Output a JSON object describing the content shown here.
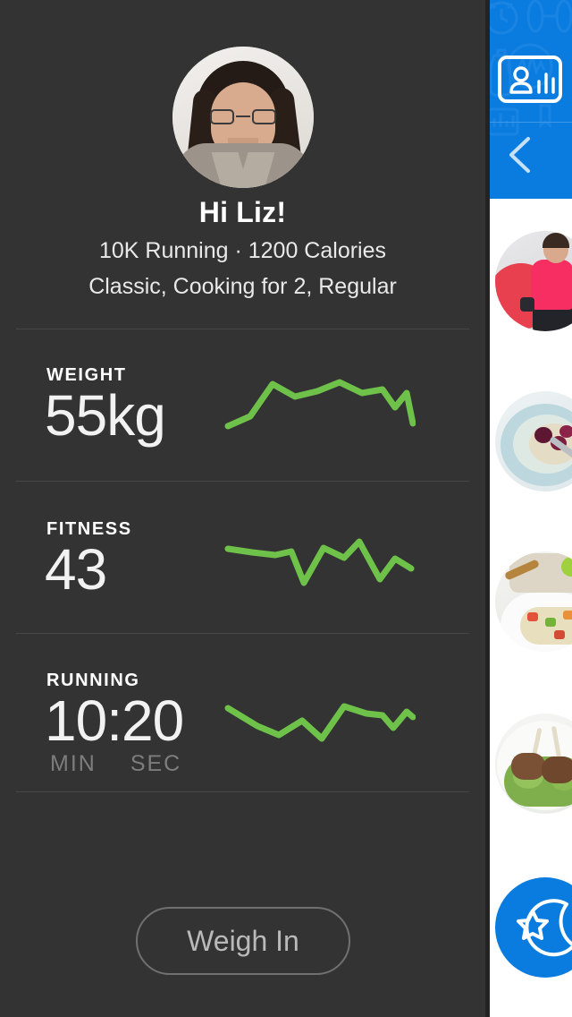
{
  "profile": {
    "avatar_name": "user-avatar-photo",
    "greeting": "Hi Liz!",
    "goals_line": "10K Running  ·  1200 Calories",
    "prefs_line": "Classic, Cooking for 2, Regular"
  },
  "stats": [
    {
      "label": "WEIGHT",
      "value": "55kg",
      "units": null,
      "sparkline_name": "weight-sparkline"
    },
    {
      "label": "FITNESS",
      "value": "43",
      "units": null,
      "sparkline_name": "fitness-sparkline"
    },
    {
      "label": "RUNNING",
      "value": "10:20",
      "units": {
        "min": "MIN",
        "sec": "SEC"
      },
      "sparkline_name": "running-sparkline"
    }
  ],
  "actions": {
    "weigh_in_label": "Weigh In"
  },
  "right_panel": {
    "badge_icon": "person-stats-badge-icon",
    "back_icon": "chevron-left-icon",
    "thumbnails": [
      {
        "name": "thumb-workout-woman"
      },
      {
        "name": "thumb-berry-oatmeal-bowl"
      },
      {
        "name": "thumb-salad-plate"
      },
      {
        "name": "thumb-lamb-chops-peas"
      }
    ],
    "moon_icon": "moon-star-icon"
  },
  "colors": {
    "panel_bg": "#333333",
    "accent_green": "#6ec24a",
    "accent_blue": "#0a7ce0",
    "divider": "#474747",
    "muted_text": "#7d7d7d"
  },
  "chart_data": [
    {
      "type": "line",
      "title": "WEIGHT",
      "series": [
        {
          "name": "weight",
          "values": [
            12,
            40,
            74,
            58,
            66,
            78,
            62,
            60,
            70,
            42,
            66,
            22
          ]
        }
      ],
      "x": [
        0,
        1,
        2,
        3,
        4,
        5,
        6,
        7,
        8,
        9,
        10,
        11
      ],
      "ylim": [
        0,
        100
      ],
      "xlabel": "",
      "ylabel": "",
      "grid": false,
      "legend": "none"
    },
    {
      "type": "line",
      "title": "FITNESS",
      "series": [
        {
          "name": "fitness",
          "values": [
            70,
            62,
            58,
            60,
            66,
            8,
            70,
            48,
            52,
            82,
            18,
            56,
            34
          ]
        }
      ],
      "x": [
        0,
        1,
        2,
        3,
        4,
        5,
        6,
        7,
        8,
        9,
        10,
        11,
        12
      ],
      "ylim": [
        0,
        100
      ],
      "xlabel": "",
      "ylabel": "",
      "grid": false,
      "legend": "none"
    },
    {
      "type": "line",
      "title": "RUNNING",
      "series": [
        {
          "name": "running",
          "values": [
            72,
            46,
            30,
            52,
            20,
            74,
            60,
            58,
            56,
            34,
            40,
            62,
            50
          ]
        }
      ],
      "x": [
        0,
        1,
        2,
        3,
        4,
        5,
        6,
        7,
        8,
        9,
        10,
        11,
        12
      ],
      "ylim": [
        0,
        100
      ],
      "xlabel": "",
      "ylabel": "",
      "grid": false,
      "legend": "none"
    }
  ]
}
